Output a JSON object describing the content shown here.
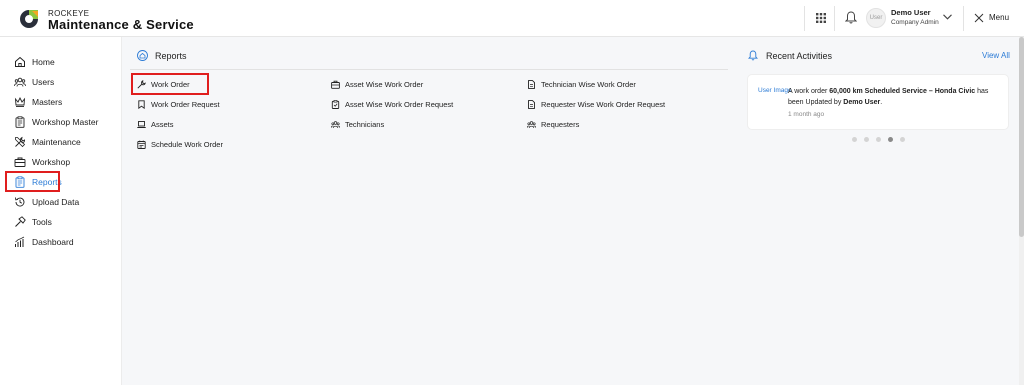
{
  "header": {
    "brand_top": "ROCKEYE",
    "brand_main": "Maintenance & Service",
    "avatar_alt": "User",
    "user_name": "Demo User",
    "user_role": "Company Admin",
    "menu_label": "Menu"
  },
  "sidebar": {
    "items": [
      {
        "label": "Home",
        "icon": "home-icon"
      },
      {
        "label": "Users",
        "icon": "users-icon"
      },
      {
        "label": "Masters",
        "icon": "crown-icon"
      },
      {
        "label": "Workshop Master",
        "icon": "clipboard-icon"
      },
      {
        "label": "Maintenance",
        "icon": "tools-icon"
      },
      {
        "label": "Workshop",
        "icon": "briefcase-icon"
      },
      {
        "label": "Reports",
        "icon": "report-icon",
        "active": true
      },
      {
        "label": "Upload Data",
        "icon": "history-icon"
      },
      {
        "label": "Tools",
        "icon": "hammer-icon"
      },
      {
        "label": "Dashboard",
        "icon": "chart-icon"
      }
    ]
  },
  "reports": {
    "title": "Reports",
    "links": [
      {
        "label": "Work Order",
        "icon": "wrench-icon"
      },
      {
        "label": "Asset Wise Work Order",
        "icon": "briefcase-icon"
      },
      {
        "label": "Technician Wise Work Order",
        "icon": "document-icon"
      },
      {
        "label": "Work Order Request",
        "icon": "bookmark-icon"
      },
      {
        "label": "Asset Wise Work Order Request",
        "icon": "clipboard-icon"
      },
      {
        "label": "Requester Wise Work Order Request",
        "icon": "document-icon"
      },
      {
        "label": "Assets",
        "icon": "laptop-icon"
      },
      {
        "label": "Technicians",
        "icon": "users-icon"
      },
      {
        "label": "Requesters",
        "icon": "users-icon"
      },
      {
        "label": "Schedule Work Order",
        "icon": "calendar-icon"
      }
    ]
  },
  "recent": {
    "title": "Recent Activities",
    "view_all": "View All",
    "activity": {
      "img_alt": "User Image",
      "text_pre": "A work order ",
      "text_bold": "60,000 km Scheduled Service – Honda Civic",
      "text_mid": " has been Updated by ",
      "text_user": "Demo User",
      "text_end": ".",
      "time": "1 month ago"
    },
    "dots_count": 5,
    "active_dot": 3
  },
  "colors": {
    "accent": "#2b7bd6",
    "highlight": "#e01e1e"
  }
}
